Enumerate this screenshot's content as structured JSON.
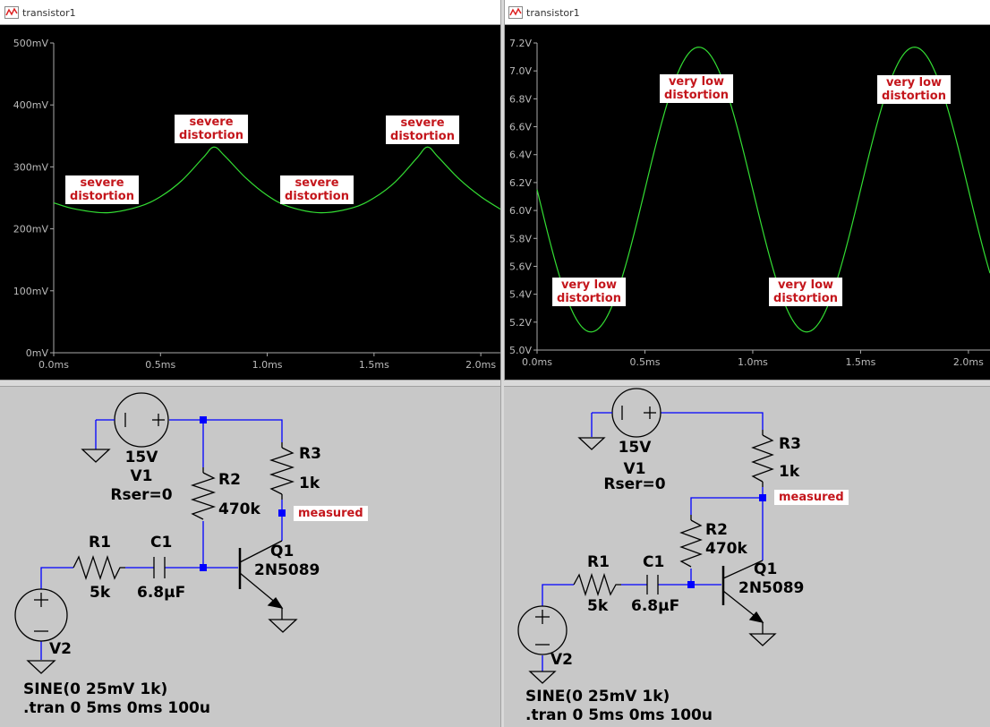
{
  "windows": {
    "left_plot_title": "transistor1",
    "right_plot_title": "transistor1"
  },
  "left_plot": {
    "y_ticks": [
      "500mV",
      "400mV",
      "300mV",
      "200mV",
      "100mV",
      "0mV"
    ],
    "x_ticks": [
      "0.0ms",
      "0.5ms",
      "1.0ms",
      "1.5ms",
      "2.0ms"
    ],
    "annotations": [
      {
        "line1": "severe",
        "line2": "distortion"
      },
      {
        "line1": "severe",
        "line2": "distortion"
      },
      {
        "line1": "severe",
        "line2": "distortion"
      },
      {
        "line1": "severe",
        "line2": "distortion"
      }
    ]
  },
  "right_plot": {
    "y_ticks": [
      "7.2V",
      "7.0V",
      "6.8V",
      "6.6V",
      "6.4V",
      "6.2V",
      "6.0V",
      "5.8V",
      "5.6V",
      "5.4V",
      "5.2V",
      "5.0V"
    ],
    "x_ticks": [
      "0.0ms",
      "0.5ms",
      "1.0ms",
      "1.5ms",
      "2.0ms"
    ],
    "annotations": [
      {
        "line1": "very low",
        "line2": "distortion"
      },
      {
        "line1": "very low",
        "line2": "distortion"
      },
      {
        "line1": "very low",
        "line2": "distortion"
      },
      {
        "line1": "very low",
        "line2": "distortion"
      }
    ]
  },
  "chart_data": [
    {
      "type": "line",
      "title": "",
      "xlabel": "",
      "ylabel": "",
      "xlim": [
        0,
        2.1
      ],
      "ylim": [
        0,
        500
      ],
      "x_unit": "ms",
      "y_unit": "mV",
      "grid": false,
      "series": [
        {
          "color": "#33dd33",
          "x": [
            0,
            0.1,
            0.25,
            0.4,
            0.5,
            0.6,
            0.7,
            0.75,
            0.8,
            0.9,
            1.0,
            1.1,
            1.25,
            1.4,
            1.5,
            1.6,
            1.7,
            1.75,
            1.8,
            1.9,
            2.0,
            2.1
          ],
          "values": [
            242,
            232,
            226,
            236,
            252,
            278,
            315,
            332,
            318,
            282,
            254,
            236,
            226,
            234,
            250,
            276,
            314,
            332,
            316,
            280,
            252,
            230
          ]
        }
      ]
    },
    {
      "type": "line",
      "title": "",
      "xlabel": "",
      "ylabel": "",
      "xlim": [
        0,
        2.1
      ],
      "ylim": [
        5.0,
        7.2
      ],
      "x_unit": "ms",
      "y_unit": "V",
      "grid": false,
      "series": [
        {
          "color": "#33dd33",
          "offset": 6.15,
          "amplitude": 1.02,
          "frequency_khz": 1,
          "phase": "inverted sine",
          "x": [
            0,
            0.25,
            0.5,
            0.75,
            1.0,
            1.25,
            1.5,
            1.75,
            2.0,
            2.1
          ],
          "values": [
            6.15,
            5.13,
            6.15,
            7.17,
            6.15,
            5.13,
            6.15,
            7.17,
            6.15,
            5.55
          ]
        }
      ]
    }
  ],
  "left_schematic": {
    "v1_value": "15V",
    "v1_name": "V1",
    "v1_rser": "Rser=0",
    "r2_name": "R2",
    "r2_value": "470k",
    "r3_name": "R3",
    "r3_value": "1k",
    "measured_label": "measured",
    "r1_name": "R1",
    "r1_value": "5k",
    "c1_name": "C1",
    "c1_value": "6.8µF",
    "q1_name": "Q1",
    "q1_model": "2N5089",
    "v2_name": "V2",
    "spice_line1": "SINE(0 25mV 1k)",
    "spice_line2": ".tran 0 5ms 0ms 100u"
  },
  "right_schematic": {
    "v1_value": "15V",
    "v1_name": "V1",
    "v1_rser": "Rser=0",
    "r3_name": "R3",
    "r3_value": "1k",
    "measured_label": "measured",
    "r2_name": "R2",
    "r2_value": "470k",
    "r1_name": "R1",
    "r1_value": "5k",
    "c1_name": "C1",
    "c1_value": "6.8µF",
    "q1_name": "Q1",
    "q1_model": "2N5089",
    "v2_name": "V2",
    "spice_line1": "SINE(0 25mV 1k)",
    "spice_line2": ".tran 0 5ms 0ms 100u"
  },
  "colors": {
    "trace": "#33dd33",
    "plot_bg": "#000000",
    "axis": "#aaaaaa",
    "annotation_text": "#c4161c",
    "wire": "#0000ff",
    "schematic_bg": "#c8c8c8"
  }
}
